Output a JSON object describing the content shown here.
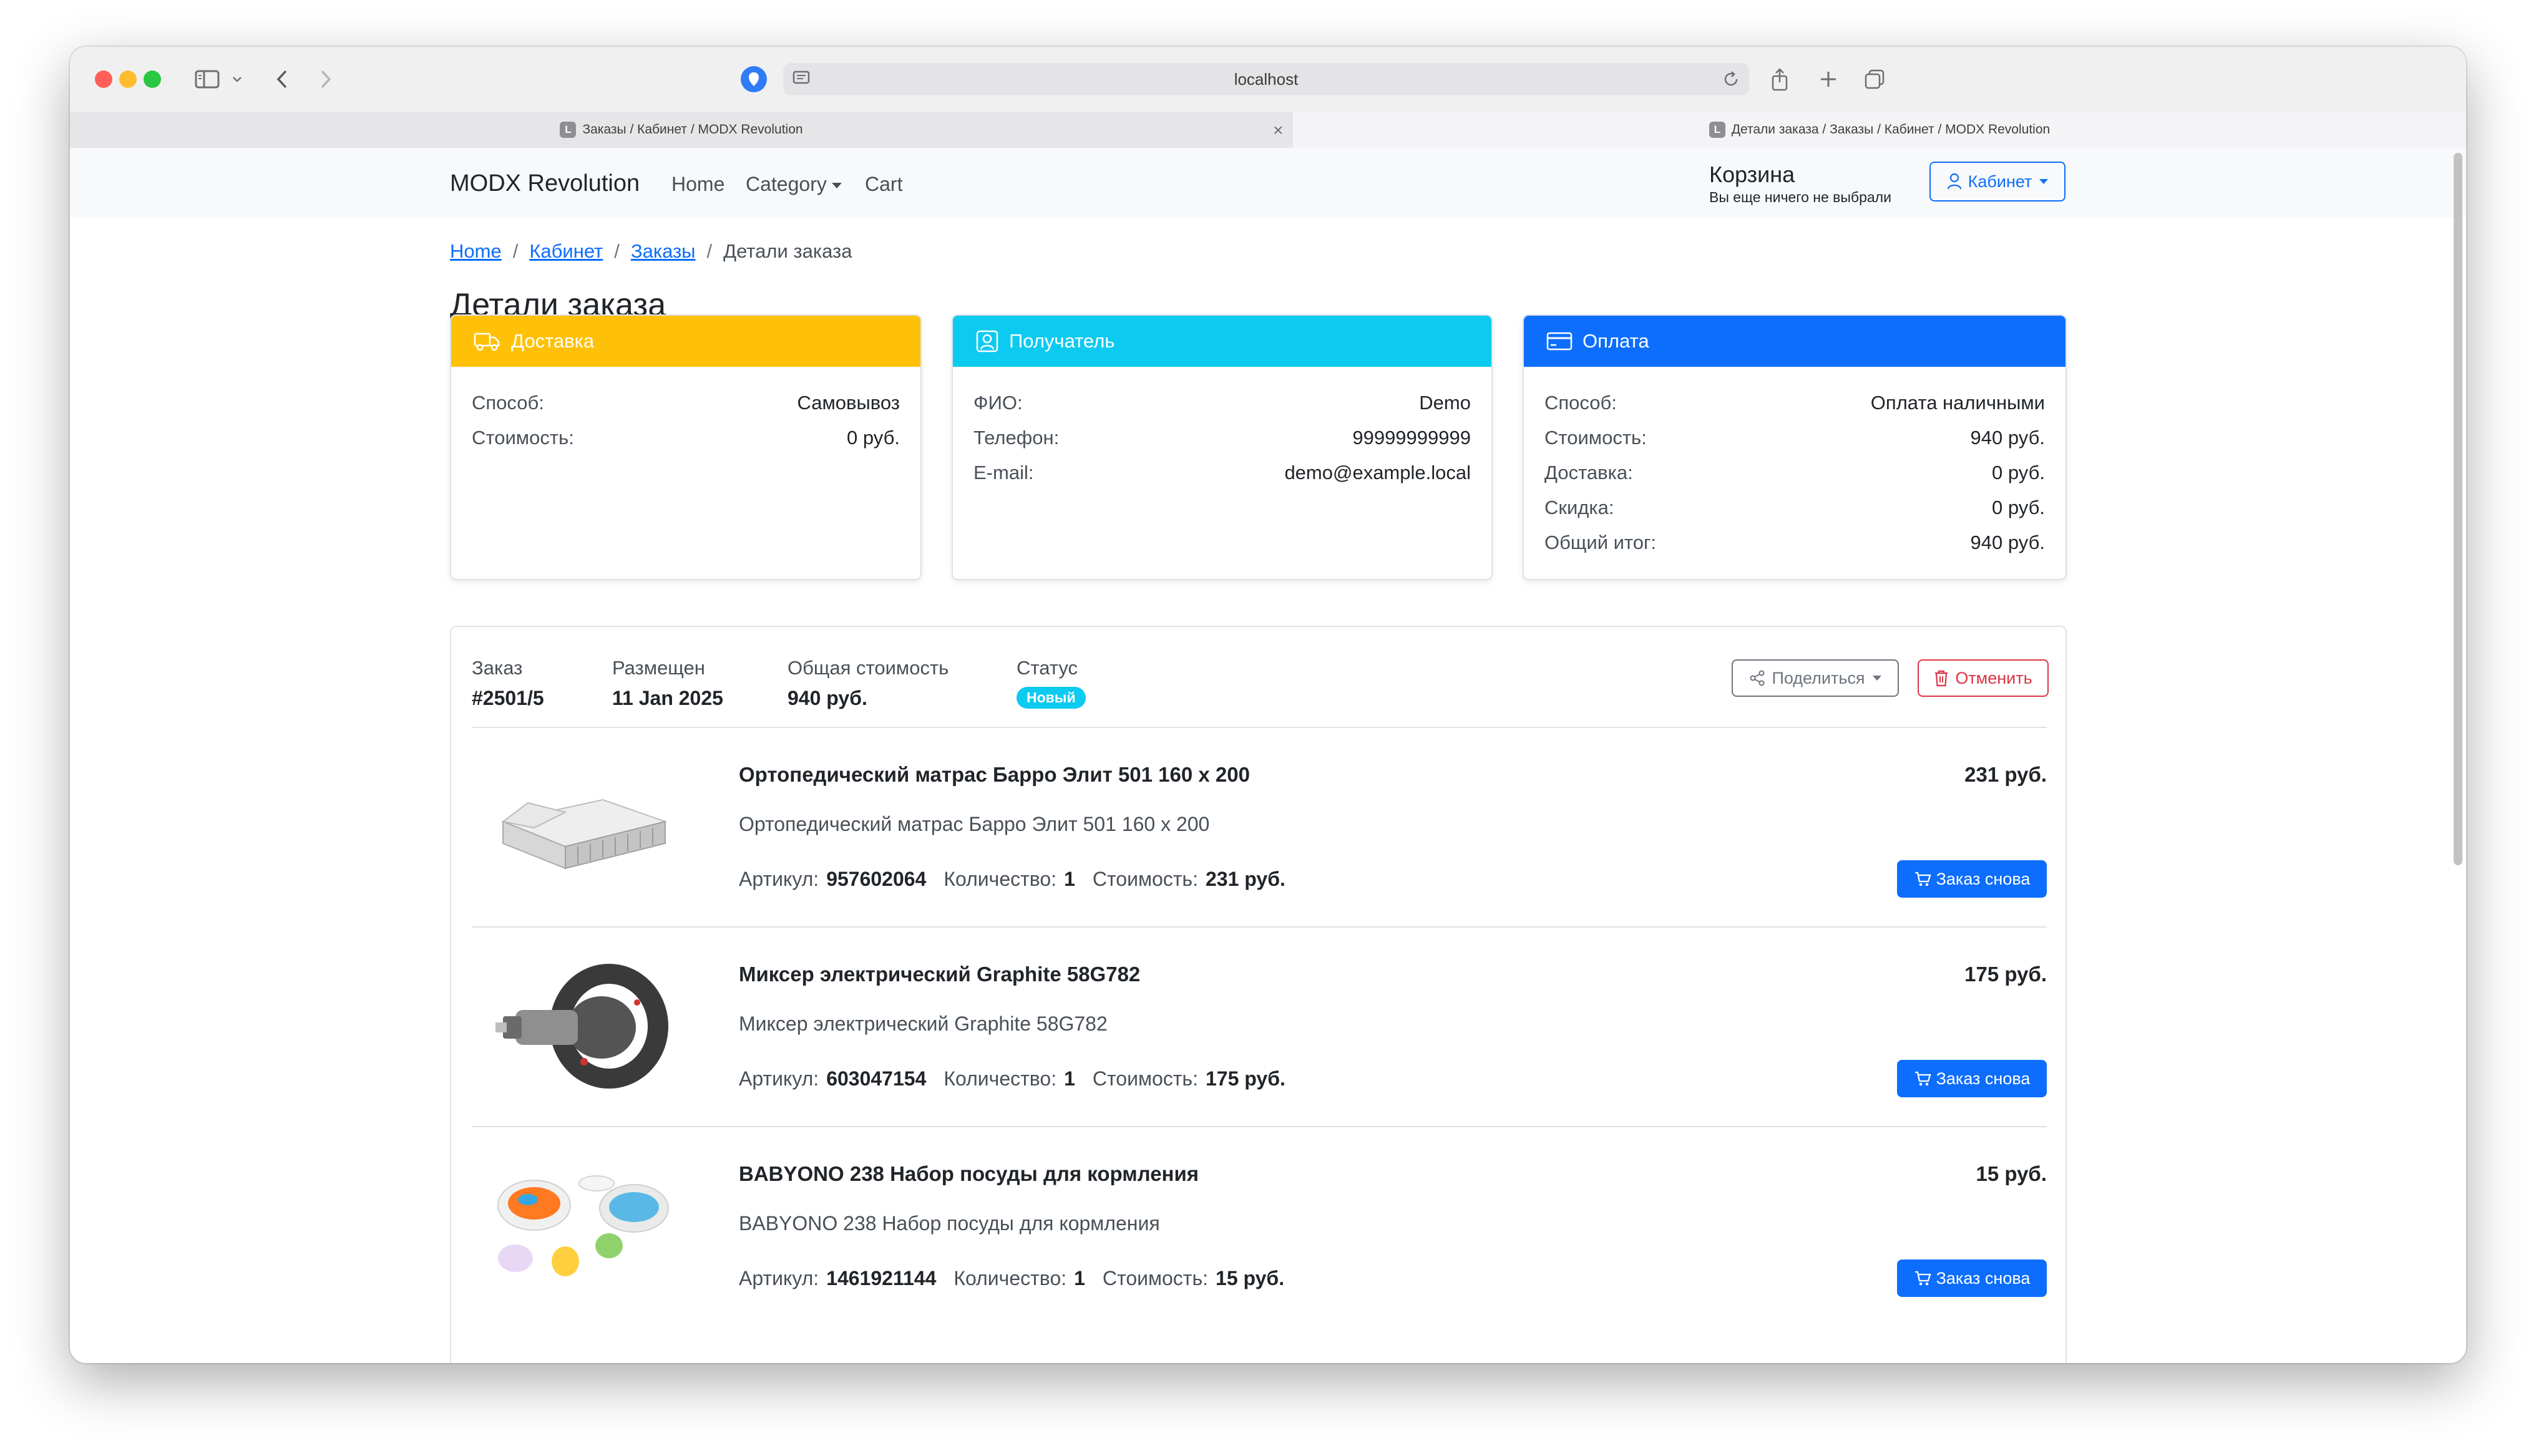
{
  "browser": {
    "address": "localhost",
    "tabs": [
      {
        "label": "Заказы / Кабинет / MODX Revolution",
        "favicon": "L"
      },
      {
        "label": "Детали заказа / Заказы / Кабинет / MODX Revolution",
        "favicon": "L"
      }
    ],
    "tab_close": "×"
  },
  "navbar": {
    "brand": "MODX Revolution",
    "links": [
      "Home",
      "Category",
      "Cart"
    ],
    "cart_title": "Корзина",
    "cart_subtitle": "Вы еще ничего не выбрали",
    "account_button": "Кабинет"
  },
  "breadcrumb": {
    "items": [
      "Home",
      "Кабинет",
      "Заказы"
    ],
    "current": "Детали заказа",
    "separator": "/"
  },
  "page_title": "Детали заказа",
  "cards": {
    "delivery": {
      "title": "Доставка",
      "color": "#ffc107",
      "rows": [
        {
          "k": "Способ:",
          "v": "Самовывоз"
        },
        {
          "k": "Стоимость:",
          "v": "0 руб."
        }
      ]
    },
    "recipient": {
      "title": "Получатель",
      "color": "#0dcaf0",
      "rows": [
        {
          "k": "ФИО:",
          "v": "Demo"
        },
        {
          "k": "Телефон:",
          "v": "99999999999"
        },
        {
          "k": "E-mail:",
          "v": "demo@example.local"
        }
      ]
    },
    "payment": {
      "title": "Оплата",
      "color": "#0d6efd",
      "rows": [
        {
          "k": "Способ:",
          "v": "Оплата наличными"
        },
        {
          "k": "Стоимость:",
          "v": "940 руб."
        },
        {
          "k": "Доставка:",
          "v": "0 руб."
        },
        {
          "k": "Скидка:",
          "v": "0 руб."
        },
        {
          "k": "Общий итог:",
          "v": "940 руб."
        }
      ]
    }
  },
  "order": {
    "number_label": "Заказ",
    "number": "#2501/5",
    "placed_label": "Размещен",
    "placed": "11 Jan 2025",
    "total_label": "Общая стоимость",
    "total": "940 руб.",
    "status_label": "Статус",
    "status": "Новый",
    "share_button": "Поделиться",
    "cancel_button": "Отменить"
  },
  "items_labels": {
    "sku": "Артикул:",
    "qty": "Количество:",
    "cost": "Стоимость:",
    "reorder": "Заказ снова"
  },
  "items": [
    {
      "title": "Ортопедический матрас Барро Элит 501 160 x 200",
      "price": "231 руб.",
      "description": "Ортопедический матрас Барро Элит 501 160 x 200",
      "sku": "957602064",
      "qty": "1",
      "cost": "231 руб.",
      "image": "mattress-image"
    },
    {
      "title": "Миксер электрический Graphite 58G782",
      "price": "175 руб.",
      "description": "Миксер электрический Graphite 58G782",
      "sku": "603047154",
      "qty": "1",
      "cost": "175 руб.",
      "image": "mixer-image"
    },
    {
      "title": "BABYONO 238 Набор посуды для кормления",
      "price": "15 руб.",
      "description": "BABYONO 238 Набор посуды для кормления",
      "sku": "1461921144",
      "qty": "1",
      "cost": "15 руб.",
      "image": "tableware-image"
    }
  ]
}
